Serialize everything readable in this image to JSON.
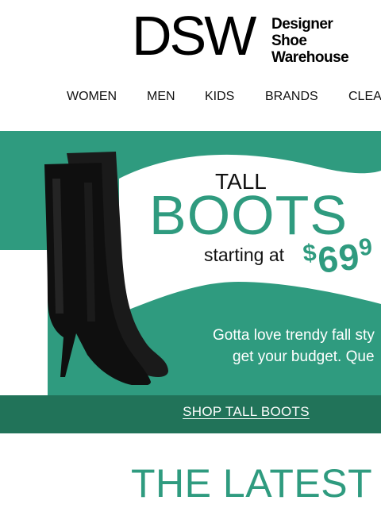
{
  "brand": {
    "mark": "DSW",
    "tagline": [
      "Designer",
      "Shoe",
      "Warehouse"
    ]
  },
  "nav": {
    "items": [
      "WOMEN",
      "MEN",
      "KIDS",
      "BRANDS",
      "CLEA"
    ]
  },
  "hero": {
    "tall": "TALL",
    "boots": "BOOTS",
    "starting_at": "starting at",
    "price_currency": "$",
    "price_value": "69",
    "price_cut": "9",
    "copy_line1": "Gotta love trendy fall sty",
    "copy_line2": "get your budget. Que",
    "image": "black-tall-boot-image",
    "colors": {
      "teal": "#2f9b7f",
      "dark_teal": "#217359"
    }
  },
  "cta": {
    "label": "SHOP TALL BOOTS"
  },
  "section": {
    "title": "THE LATEST"
  }
}
